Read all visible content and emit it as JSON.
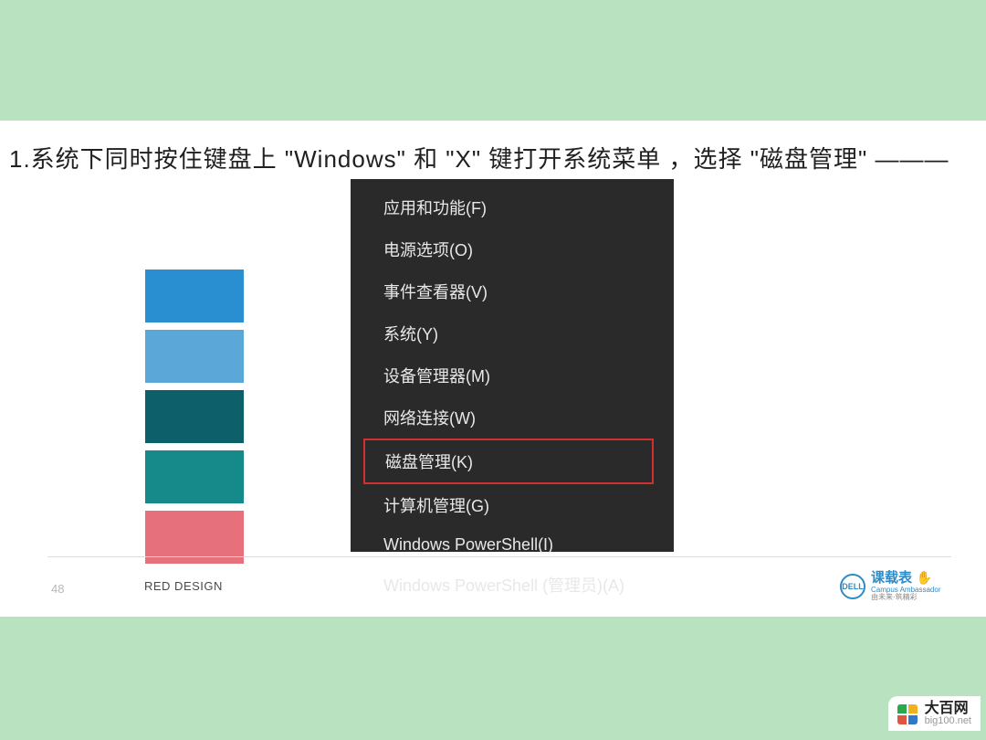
{
  "instruction": "1.系统下同时按住键盘上 \"Windows\" 和 \"X\" 键打开系统菜单 ，选择 \"磁盘管理\" ———",
  "swatches": [
    "#2a8fd0",
    "#5ba8d8",
    "#0d5f6a",
    "#168a8a",
    "#e6717d"
  ],
  "menu": {
    "items": [
      {
        "label": "应用和功能(F)",
        "highlighted": false
      },
      {
        "label": "电源选项(O)",
        "highlighted": false
      },
      {
        "label": "事件查看器(V)",
        "highlighted": false
      },
      {
        "label": "系统(Y)",
        "highlighted": false
      },
      {
        "label": "设备管理器(M)",
        "highlighted": false
      },
      {
        "label": "网络连接(W)",
        "highlighted": false
      },
      {
        "label": "磁盘管理(K)",
        "highlighted": true
      },
      {
        "label": "计算机管理(G)",
        "highlighted": false
      },
      {
        "label": "Windows PowerShell(I)",
        "highlighted": false
      },
      {
        "label": "Windows PowerShell (管理员)(A)",
        "highlighted": false
      }
    ]
  },
  "footer": {
    "page_number": "48",
    "design_label": "RED DESIGN",
    "dell": {
      "brand": "DELL",
      "title": "课载表",
      "sub1": "Campus Ambassador",
      "sub2": "由未来·筑精彩"
    }
  },
  "watermark": {
    "name": "大百网",
    "url": "big100.net"
  }
}
